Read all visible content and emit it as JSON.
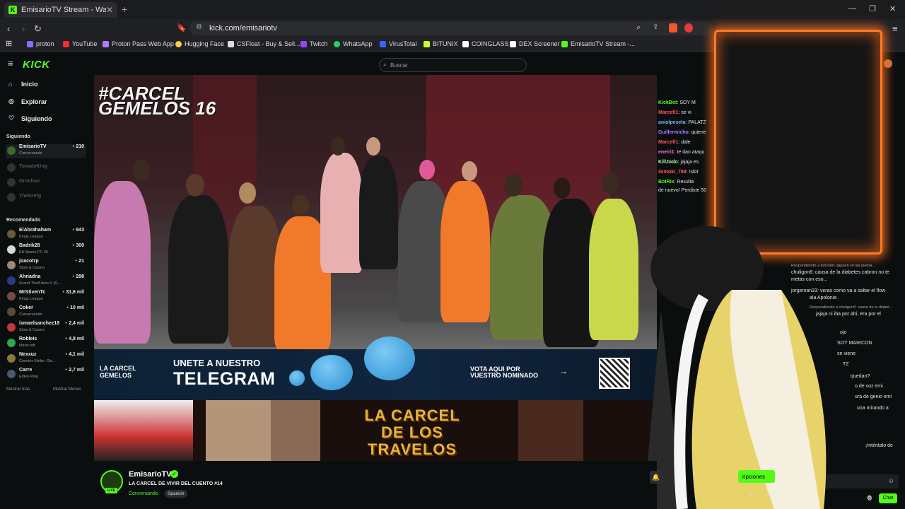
{
  "browser": {
    "tab_title": "EmisarioTV Stream - Watch L",
    "url": "kick.com/emisariotv",
    "bookmarks": [
      {
        "label": "proton",
        "color": "#8a6cff"
      },
      {
        "label": "YouTube",
        "color": "#ff2a2a"
      },
      {
        "label": "Proton Pass Web App",
        "color": "#b07cff"
      },
      {
        "label": "Hugging Face",
        "color": "#ffce3d"
      },
      {
        "label": "CSFloat - Buy & Sell...",
        "color": "#dddddd"
      },
      {
        "label": "Twitch",
        "color": "#9146ff"
      },
      {
        "label": "WhatsApp",
        "color": "#25d366"
      },
      {
        "label": "VirusTotal",
        "color": "#3b61ff"
      },
      {
        "label": "BITUNIX",
        "color": "#c8ff2a"
      },
      {
        "label": "COINGLASS",
        "color": "#ffffff"
      },
      {
        "label": "DEX Screener",
        "color": "#ffffff"
      },
      {
        "label": "EmisarioTV Stream -...",
        "color": "#53fc18"
      }
    ]
  },
  "kick": {
    "logo": "KICK",
    "search_placeholder": "Buscar",
    "nav": [
      {
        "label": "Inicio",
        "icon": "home-icon"
      },
      {
        "label": "Explorar",
        "icon": "compass-icon"
      },
      {
        "label": "Siguiendo",
        "icon": "heart-icon"
      }
    ],
    "following_title": "Siguiendo",
    "following": [
      {
        "name": "EmisarioTV",
        "sub": "Conversando",
        "viewers": "210",
        "online": true
      },
      {
        "name": "TomateKing",
        "sub": "",
        "viewers": "",
        "online": false
      },
      {
        "name": "Gronhair",
        "sub": "",
        "viewers": "",
        "online": false
      },
      {
        "name": "TheGrefg",
        "sub": "",
        "viewers": "",
        "online": false
      }
    ],
    "recommended_title": "Recomendado",
    "recommended": [
      {
        "name": "ElAbrahaham",
        "sub": "Kings League",
        "viewers": "943"
      },
      {
        "name": "Badrik28",
        "sub": "EA Sports FC 26",
        "viewers": "300"
      },
      {
        "name": "joacotrp",
        "sub": "Slots & Casino",
        "viewers": "21"
      },
      {
        "name": "Ahriadna",
        "sub": "Grand Theft Auto V (G...",
        "viewers": "298"
      },
      {
        "name": "MrStivenTc",
        "sub": "Kings League",
        "viewers": "31,6 mil"
      },
      {
        "name": "Coker",
        "sub": "Conversando",
        "viewers": "10 mil"
      },
      {
        "name": "ismaelsanchez18",
        "sub": "Slots & Casino",
        "viewers": "2,4 mil"
      },
      {
        "name": "Robleis",
        "sub": "Minecraft",
        "viewers": "4,8 mil"
      },
      {
        "name": "Nexxuz",
        "sub": "Counter-Strike: Glo...",
        "viewers": "4,1 mil"
      },
      {
        "name": "Carre",
        "sub": "Elden Ring",
        "viewers": "2,7 mil"
      }
    ],
    "show_more": "Mostrar más",
    "show_less": "Mostrar Menos"
  },
  "video": {
    "overlay_title": "#CARCEL\nGEMELOS 16",
    "banner_left": "LA CARCEL\nGEMELOS",
    "banner_join": "UNETE A NUESTRO",
    "banner_telegram": "TELEGRAM",
    "banner_vote": "VOTA AQUI POR\nVUESTRO NOMINADO",
    "bottom_title": "LA CARCEL\nDE LOS\nTRAVELOS"
  },
  "chat": {
    "messages": [
      {
        "user": "KickBot",
        "text": ": SOY M",
        "color": "#53fc18"
      },
      {
        "user": "Marcefi1",
        "text": ": se vi",
        "color": "#ff5a5a"
      },
      {
        "user": "aniolpeseta",
        "text": ": PALATZ",
        "color": "#7ab8ff"
      },
      {
        "user": "Guillermicho",
        "text": ": quiene",
        "color": "#b07cff"
      },
      {
        "user": "Marcefi1",
        "text": ": dale",
        "color": "#ff5a5a"
      },
      {
        "user": "eneiri1",
        "text": ": te dan ataqu",
        "color": "#ff6fbf"
      },
      {
        "user": "KillJodo",
        "text": ": jajaja es",
        "color": "#aaffaa"
      },
      {
        "user": "Gintoki_788",
        "text": ": !slot",
        "color": "#ff5a5a"
      },
      {
        "user": "BotRix",
        "text": ": Resulta",
        "color": "#53fc18"
      },
      {
        "user": "",
        "text": "de nuevo! Perdiste 50",
        "color": "#ffffff"
      }
    ],
    "lower_messages": [
      "Respondiendo a KillJodo: alguien ve las pierna...",
      "chuligon6: causa de la diabetes cabron no te",
      "metas con eso...",
      "jorgeman33: veras como va a saltar el flow",
      "ala Apolonia",
      "Respondiendo a chuligon6: causa de la diabet...",
      "jajaja ni iba por ahi, era por el",
      "ojo",
      "SOY MARICON",
      "se viene",
      "TZ",
      "quedan?",
      "o de voz emi",
      "ura de genio emi",
      "una mirando a",
      "¡Inténtalo de"
    ],
    "chat_button": "Chat"
  },
  "stream_info": {
    "name": "EmisarioTV",
    "title": "LA CARCEL DE VIVIR DEL CUENTO #14",
    "category": "Conversando",
    "language": "Spanish",
    "live": "LIVE",
    "subscribe_label": "ripciones"
  }
}
